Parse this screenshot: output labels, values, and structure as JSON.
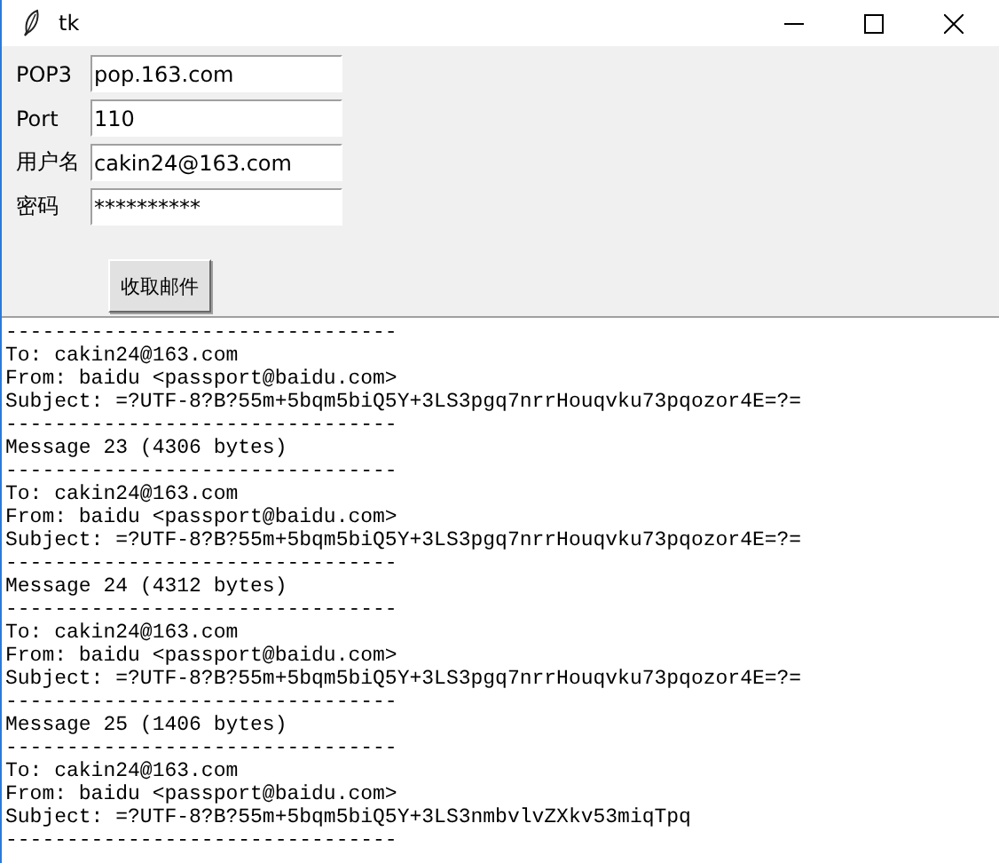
{
  "window": {
    "title": "tk"
  },
  "fields": [
    {
      "label": "POP3",
      "value": "pop.163.com"
    },
    {
      "label": "Port",
      "value": "110"
    },
    {
      "label": "用户名",
      "value": "cakin24@163.com"
    },
    {
      "label": "密码",
      "value": "**********"
    }
  ],
  "button": {
    "label": "收取邮件"
  },
  "output": {
    "lines": [
      "--------------------------------",
      "To: cakin24@163.com",
      "From: baidu <passport@baidu.com>",
      "Subject: =?UTF-8?B?55m+5bqm5biQ5Y+3LS3pgq7nrrHouqvku73pqozor4E=?=",
      "--------------------------------",
      "Message 23 (4306 bytes)",
      "--------------------------------",
      "To: cakin24@163.com",
      "From: baidu <passport@baidu.com>",
      "Subject: =?UTF-8?B?55m+5bqm5biQ5Y+3LS3pgq7nrrHouqvku73pqozor4E=?=",
      "--------------------------------",
      "Message 24 (4312 bytes)",
      "--------------------------------",
      "To: cakin24@163.com",
      "From: baidu <passport@baidu.com>",
      "Subject: =?UTF-8?B?55m+5bqm5biQ5Y+3LS3pgq7nrrHouqvku73pqozor4E=?=",
      "--------------------------------",
      "Message 25 (1406 bytes)",
      "--------------------------------",
      "To: cakin24@163.com",
      "From: baidu <passport@baidu.com>",
      "Subject: =?UTF-8?B?55m+5bqm5biQ5Y+3LS3nmbvlvZXkv53miqTpq",
      "--------------------------------"
    ]
  }
}
